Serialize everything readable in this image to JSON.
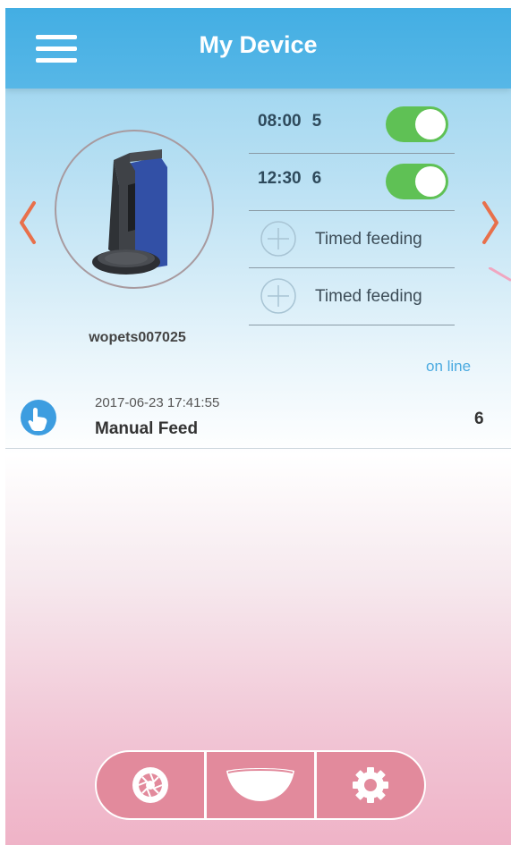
{
  "header": {
    "title": "My Device",
    "menu_icon": "hamburger-menu-icon"
  },
  "navigation": {
    "prev_icon": "chevron-left-icon",
    "next_icon": "chevron-right-icon",
    "arrow_color": "#e8704b"
  },
  "device": {
    "name": "wopets007025",
    "image": "pet-feeder-device"
  },
  "schedule": [
    {
      "time": "08:00",
      "portions": "5",
      "enabled": true
    },
    {
      "time": "12:30",
      "portions": "6",
      "enabled": true
    },
    {
      "add_label": "Timed feeding"
    },
    {
      "add_label": "Timed feeding"
    }
  ],
  "status": "on line",
  "log": [
    {
      "timestamp": "2017-06-23 17:41:55",
      "type": "Manual Feed",
      "amount": "6",
      "icon": "hand-tap-icon"
    }
  ],
  "bottom_bar": [
    {
      "icon": "camera-aperture-icon"
    },
    {
      "icon": "bowl-icon"
    },
    {
      "icon": "gear-icon"
    }
  ],
  "colors": {
    "header": "#43aee3",
    "toggle_on": "#5fc155",
    "status": "#4aaae0",
    "bottom_bar": "#e28a9c"
  }
}
